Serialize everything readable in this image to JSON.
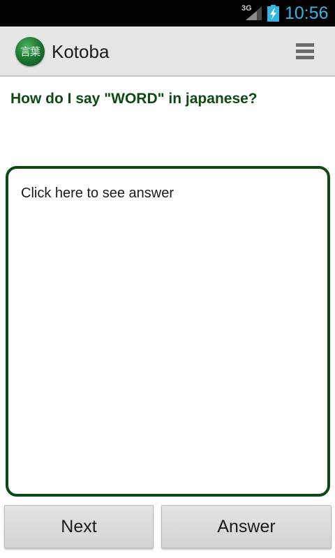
{
  "status_bar": {
    "network": "3G",
    "time": "10:56",
    "clock_color": "#33b5e5",
    "icons": [
      "signal-icon",
      "battery-charging-icon"
    ]
  },
  "action_bar": {
    "logo_text": "言葉",
    "title": "Kotoba",
    "menu_icon": "hamburger-menu-icon"
  },
  "main": {
    "question": "How do I say \"WORD\" in japanese?",
    "answer_placeholder": "Click here to see answer"
  },
  "buttons": {
    "next": "Next",
    "answer": "Answer"
  },
  "colors": {
    "accent_green": "#0b4a12",
    "action_bar_bg": "#e6e6e6"
  }
}
